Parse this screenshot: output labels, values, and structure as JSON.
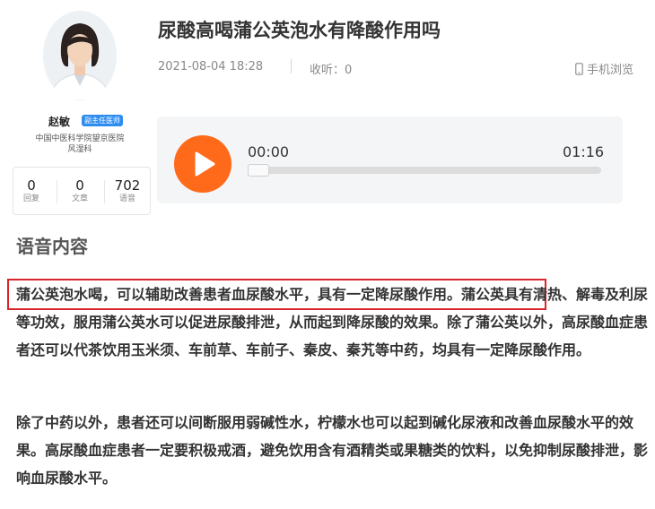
{
  "doctor": {
    "name": "赵敏",
    "title_badge": "副主任医师",
    "hospital": "中国中医科学院望京医院",
    "department": "风湿科",
    "stats": [
      {
        "value": "0",
        "label": "回复"
      },
      {
        "value": "0",
        "label": "文章"
      },
      {
        "value": "702",
        "label": "语音"
      }
    ]
  },
  "article": {
    "title": "尿酸高喝蒲公英泡水有降酸作用吗",
    "date": "2021-08-04 18:28",
    "listen_count": "收听：0",
    "mobile_browse": "手机浏览"
  },
  "player": {
    "current_time": "00:00",
    "total_time": "01:16",
    "progress": 0,
    "accent_color": "#ff6a1a"
  },
  "content": {
    "heading": "语音内容",
    "highlight_sentence": "蒲公英泡水喝，可以辅助改善患者血尿酸水平，具有一定降尿酸作用。",
    "paragraph1_rest": "蒲公英具有清热、解毒及利尿等功效，服用蒲公英水可以促进尿酸排泄，从而起到降尿酸的效果。除了蒲公英以外，高尿酸血症患者还可以代茶饮用玉米须、车前草、车前子、秦皮、秦艽等中药，均具有一定降尿酸作用。",
    "paragraph2": "除了中药以外，患者还可以间断服用弱碱性水，柠檬水也可以起到碱化尿液和改善血尿酸水平的效果。高尿酸血症患者一定要积极戒酒，避免饮用含有酒精类或果糖类的饮料，以免抑制尿酸排泄，影响血尿酸水平。",
    "highlight_color": "#d9242b"
  }
}
